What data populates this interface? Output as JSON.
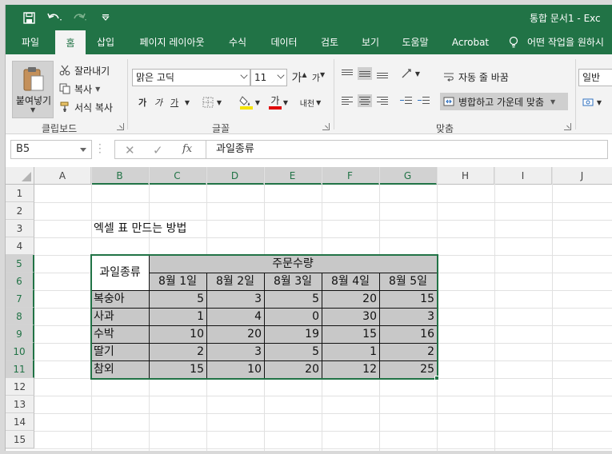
{
  "app": {
    "title": "통합 문서1 - Exc",
    "accent": "#217346"
  },
  "tabs": [
    {
      "label": "파일"
    },
    {
      "label": "홈"
    },
    {
      "label": "삽입"
    },
    {
      "label": "페이지 레이아웃"
    },
    {
      "label": "수식"
    },
    {
      "label": "데이터"
    },
    {
      "label": "검토"
    },
    {
      "label": "보기"
    },
    {
      "label": "도움말"
    },
    {
      "label": "Acrobat"
    },
    {
      "label": "어떤 작업을 원하시"
    }
  ],
  "ribbon": {
    "clipboard": {
      "paste": "붙여넣기",
      "cut": "잘라내기",
      "copy": "복사",
      "format_painter": "서식 복사",
      "group_label": "클립보드"
    },
    "font": {
      "font_name": "맑은 고딕",
      "font_size": "11",
      "grow": "가",
      "shrink": "가",
      "bold": "가",
      "italic": "가",
      "underline": "가",
      "font_color_glyph": "가",
      "phonetic": "내천",
      "group_label": "글꼴"
    },
    "alignment": {
      "wrap_text": "자동 줄 바꿈",
      "merge_center": "병합하고 가운데 맞춤",
      "group_label": "맞춤"
    },
    "number": {
      "format": "일반"
    }
  },
  "formula_bar": {
    "name_box": "B5",
    "formula": "과일종류",
    "fx": "fx"
  },
  "columns": [
    "A",
    "B",
    "C",
    "D",
    "E",
    "F",
    "G",
    "H",
    "I",
    "J"
  ],
  "rows": [
    "1",
    "2",
    "3",
    "4",
    "5",
    "6",
    "7",
    "8",
    "9",
    "10",
    "11",
    "12",
    "13",
    "14",
    "15"
  ],
  "sheet": {
    "heading": "엑셀 표 만드는 방법",
    "table": {
      "corner_header": "과일종류",
      "group_header": "주문수량",
      "dates": [
        "8월 1일",
        "8월 2일",
        "8월 3일",
        "8월 4일",
        "8월 5일"
      ],
      "fruits": [
        "복숭아",
        "사과",
        "수박",
        "딸기",
        "참외"
      ],
      "values": [
        [
          "5",
          "3",
          "5",
          "20",
          "15"
        ],
        [
          "1",
          "4",
          "0",
          "30",
          "3"
        ],
        [
          "10",
          "20",
          "19",
          "15",
          "16"
        ],
        [
          "2",
          "3",
          "5",
          "1",
          "2"
        ],
        [
          "15",
          "10",
          "20",
          "12",
          "25"
        ]
      ]
    }
  }
}
